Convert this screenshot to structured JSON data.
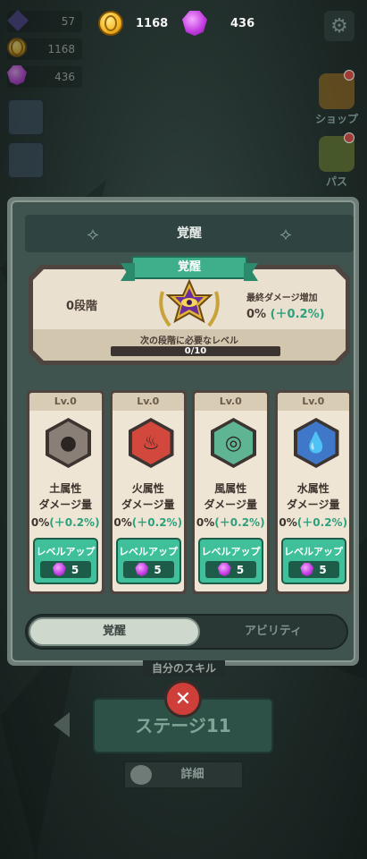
{
  "top": {
    "coins": "1168",
    "gems": "436"
  },
  "side": {
    "energy": "57",
    "coins": "1168",
    "gems": "436"
  },
  "right_menu": {
    "shop_label": "ショップ",
    "pass_label": "パス"
  },
  "panel": {
    "title": "覚醒",
    "ribbon": "覚醒",
    "stage": "0段階",
    "final_damage_label": "最終ダメージ増加",
    "final_damage_value": "0%",
    "final_damage_bonus": "(＋0.2%)",
    "next_level_label": "次の段階に必要なレベル",
    "progress_text": "0/10",
    "progress": 0
  },
  "cards": [
    {
      "level": "Lv.0",
      "name": "土属性",
      "sub": "ダメージ量",
      "value": "0%",
      "bonus": "(＋0.2%)",
      "button": "レベルアップ",
      "cost": "5",
      "icon": "earth-icon",
      "color": "#8a7f76"
    },
    {
      "level": "Lv.0",
      "name": "火属性",
      "sub": "ダメージ量",
      "value": "0%",
      "bonus": "(＋0.2%)",
      "button": "レベルアップ",
      "cost": "5",
      "icon": "fire-icon",
      "color": "#d2483c"
    },
    {
      "level": "Lv.0",
      "name": "風属性",
      "sub": "ダメージ量",
      "value": "0%",
      "bonus": "(＋0.2%)",
      "button": "レベルアップ",
      "cost": "5",
      "icon": "wind-icon",
      "color": "#5fb593"
    },
    {
      "level": "Lv.0",
      "name": "水属性",
      "sub": "ダメージ量",
      "value": "0%",
      "bonus": "(＋0.2%)",
      "button": "レベルアップ",
      "cost": "5",
      "icon": "water-icon",
      "color": "#3f78c9"
    }
  ],
  "tabs": {
    "active": "覚醒",
    "other": "アビリティ"
  },
  "bottom": {
    "skill_label": "自分のスキル",
    "stage_button": "ステージ11",
    "detail_button": "詳細"
  }
}
